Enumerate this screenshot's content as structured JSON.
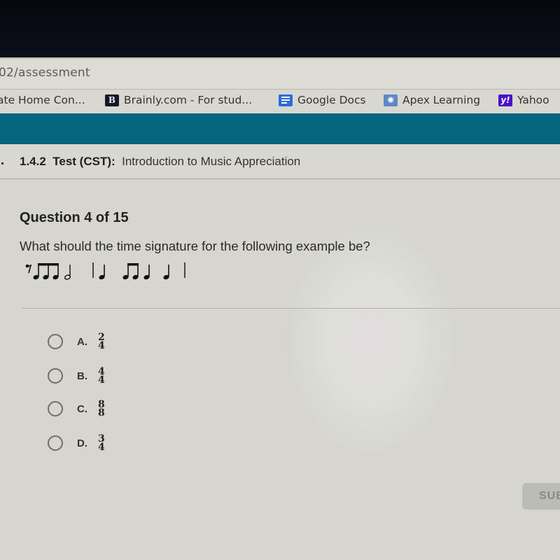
{
  "browser": {
    "url_visible": "02/assessment",
    "bookmarks": [
      {
        "label": "ate Home Con...",
        "icon": "none"
      },
      {
        "label": "Brainly.com - For stud...",
        "icon": "brainly-icon"
      },
      {
        "label": "Google Docs",
        "icon": "google-docs-icon"
      },
      {
        "label": "Apex Learning",
        "icon": "apex-learning-icon"
      },
      {
        "label": "Yahoo",
        "icon": "yahoo-icon"
      }
    ],
    "brainly_glyph": "B",
    "apex_glyph": "✺",
    "yahoo_glyph": "y!"
  },
  "course": {
    "code": "1.4.2",
    "type": "Test (CST):",
    "name": "Introduction to Music Appreciation"
  },
  "question": {
    "number_label": "Question 4 of 15",
    "prompt": "What should the time signature for the following example be?",
    "rhythm": [
      "eighth rest",
      "three beamed eighth notes",
      "half note",
      "barline",
      "quarter note",
      "two beamed eighth notes",
      "quarter note",
      "quarter note",
      "barline"
    ]
  },
  "choices": [
    {
      "letter": "A.",
      "top": "2",
      "bottom": "4"
    },
    {
      "letter": "B.",
      "top": "4",
      "bottom": "4"
    },
    {
      "letter": "C.",
      "top": "8",
      "bottom": "8"
    },
    {
      "letter": "D.",
      "top": "3",
      "bottom": "4"
    }
  ],
  "submit_label": "SUBMIT",
  "colors": {
    "accent_teal": "#05657f",
    "background": "#d6d6cf"
  }
}
